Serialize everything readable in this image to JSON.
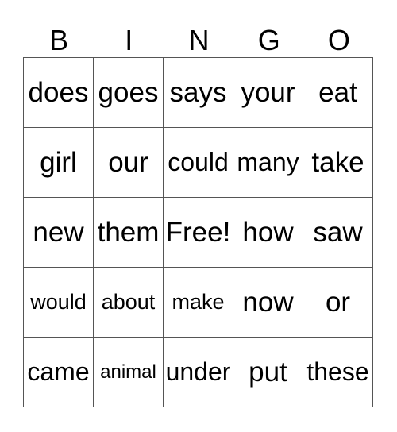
{
  "header": [
    "B",
    "I",
    "N",
    "G",
    "O"
  ],
  "rows": [
    [
      "does",
      "goes",
      "says",
      "your",
      "eat"
    ],
    [
      "girl",
      "our",
      "could",
      "many",
      "take"
    ],
    [
      "new",
      "them",
      "Free!",
      "how",
      "saw"
    ],
    [
      "would",
      "about",
      "make",
      "now",
      "or"
    ],
    [
      "came",
      "animal",
      "under",
      "put",
      "these"
    ]
  ]
}
